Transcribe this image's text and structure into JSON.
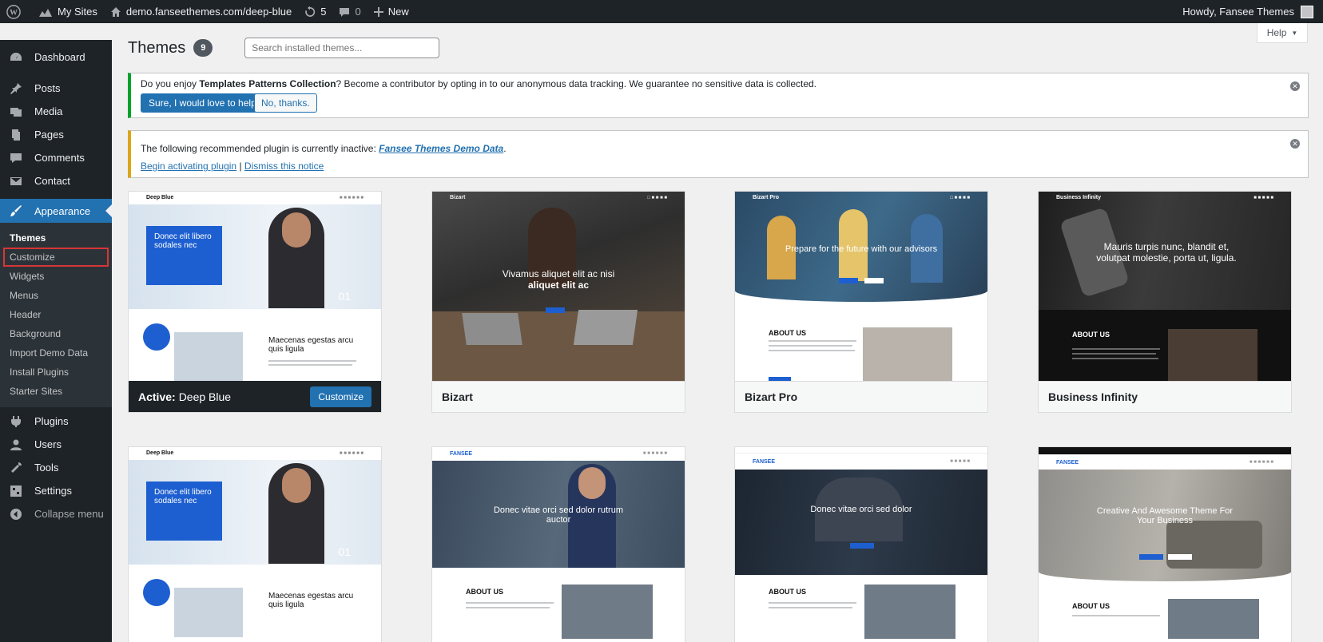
{
  "adminbar": {
    "my_sites": "My Sites",
    "site_url": "demo.fanseethemes.com/deep-blue",
    "updates": "5",
    "comments": "0",
    "new": "New",
    "howdy": "Howdy, Fansee Themes"
  },
  "sidebar": {
    "items": [
      {
        "label": "Dashboard",
        "icon": "dashboard-icon"
      },
      {
        "label": "Posts",
        "icon": "pin-icon"
      },
      {
        "label": "Media",
        "icon": "media-icon"
      },
      {
        "label": "Pages",
        "icon": "pages-icon"
      },
      {
        "label": "Comments",
        "icon": "comments-icon"
      },
      {
        "label": "Contact",
        "icon": "mail-icon"
      },
      {
        "label": "Appearance",
        "icon": "paintbrush-icon"
      }
    ],
    "appearance_sub": [
      "Themes",
      "Customize",
      "Widgets",
      "Menus",
      "Header",
      "Background",
      "Import Demo Data",
      "Install Plugins",
      "Starter Sites"
    ],
    "bottom_items": [
      {
        "label": "Plugins",
        "icon": "plugins-icon"
      },
      {
        "label": "Users",
        "icon": "users-icon"
      },
      {
        "label": "Tools",
        "icon": "tools-icon"
      },
      {
        "label": "Settings",
        "icon": "settings-icon"
      }
    ],
    "collapse": "Collapse menu"
  },
  "header": {
    "title": "Themes",
    "count": "9",
    "search_placeholder": "Search installed themes...",
    "help": "Help"
  },
  "notice1": {
    "text_a": "Do you enjoy ",
    "text_b": "Templates Patterns Collection",
    "text_c": "? Become a contributor by opting in to our anonymous data tracking. We guarantee no sensitive data is collected.",
    "primary": "Sure, I would love to help.",
    "secondary": "No, thanks."
  },
  "notice2": {
    "text": "The following recommended plugin is currently inactive: ",
    "plugin": "Fansee Themes Demo Data",
    "period": ".",
    "activate": "Begin activating plugin",
    "sep": "|",
    "dismiss": "Dismiss this notice"
  },
  "themes": [
    {
      "name": "Deep Blue",
      "active_label": "Active:",
      "customize": "Customize",
      "brand": "Deep Blue",
      "hero": "Donec elit libero sodales nec",
      "sub": "Maecenas egestas arcu quis ligula",
      "slide": "01"
    },
    {
      "name": "Bizart",
      "brand": "Bizart",
      "hero_a": "Vivamus aliquet elit ac nisi",
      "hero_b": "aliquet elit ac"
    },
    {
      "name": "Bizart Pro",
      "brand": "Bizart Pro",
      "hero": "Prepare for the future with our advisors",
      "about": "ABOUT US"
    },
    {
      "name": "Business Infinity",
      "brand": "Business Infinity",
      "hero": "Mauris turpis nunc, blandit et, volutpat molestie, porta ut, ligula.",
      "about": "ABOUT US"
    },
    {
      "brand": "Deep Blue",
      "hero": "Donec elit libero sodales nec",
      "sub": "Maecenas egestas arcu quis ligula",
      "slide": "01"
    },
    {
      "brand": "FANSEE",
      "hero": "Donec vitae orci sed dolor rutrum auctor",
      "about": "ABOUT US"
    },
    {
      "brand": "FANSEE",
      "hero": "Donec vitae orci sed dolor",
      "about": "ABOUT US"
    },
    {
      "brand": "FANSEE",
      "hero": "Creative And Awesome Theme For Your Business",
      "about": "ABOUT US"
    }
  ],
  "colors": {
    "accent": "#2271b1",
    "adminbar": "#1d2327",
    "theme_blue": "#1d5fd0"
  }
}
